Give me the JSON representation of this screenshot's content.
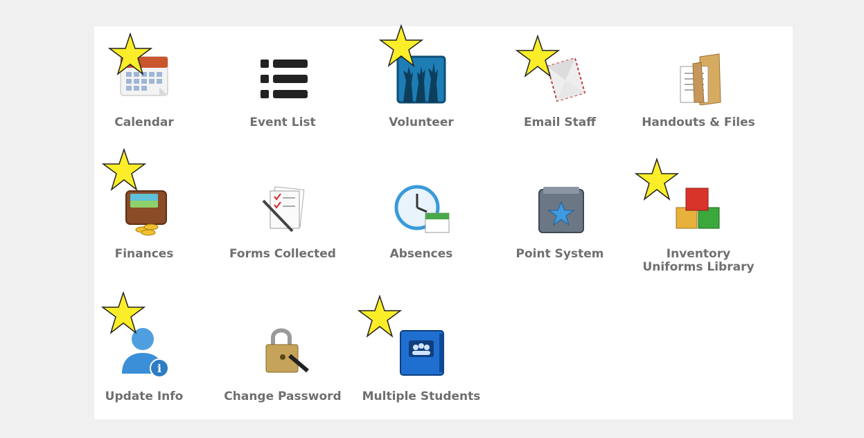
{
  "menu": {
    "tiles": [
      {
        "id": "calendar",
        "label": "Calendar",
        "icon": "calendar-icon",
        "starred": true
      },
      {
        "id": "event-list",
        "label": "Event List",
        "icon": "list-icon",
        "starred": false
      },
      {
        "id": "volunteer",
        "label": "Volunteer",
        "icon": "raised-hands-icon",
        "starred": true
      },
      {
        "id": "email-staff",
        "label": "Email Staff",
        "icon": "envelope-icon",
        "starred": true
      },
      {
        "id": "handouts-files",
        "label": "Handouts & Files",
        "icon": "folder-icon",
        "starred": false
      },
      {
        "id": "finances",
        "label": "Finances",
        "icon": "wallet-icon",
        "starred": true
      },
      {
        "id": "forms-collected",
        "label": "Forms Collected",
        "icon": "forms-icon",
        "starred": false
      },
      {
        "id": "absences",
        "label": "Absences",
        "icon": "clock-calendar-icon",
        "starred": false
      },
      {
        "id": "point-system",
        "label": "Point System",
        "icon": "star-folder-icon",
        "starred": false
      },
      {
        "id": "inventory",
        "label": "Inventory",
        "label2": "Uniforms Library",
        "icon": "boxes-icon",
        "starred": true
      },
      {
        "id": "update-info",
        "label": "Update Info",
        "icon": "user-info-icon",
        "starred": true
      },
      {
        "id": "change-password",
        "label": "Change Password",
        "icon": "padlock-icon",
        "starred": false
      },
      {
        "id": "multiple-students",
        "label": "Multiple Students",
        "icon": "group-binder-icon",
        "starred": true
      }
    ]
  },
  "colors": {
    "background": "#f0f0f0",
    "panel": "#ffffff",
    "label": "#6f6f6f",
    "star": "#fbee29"
  }
}
